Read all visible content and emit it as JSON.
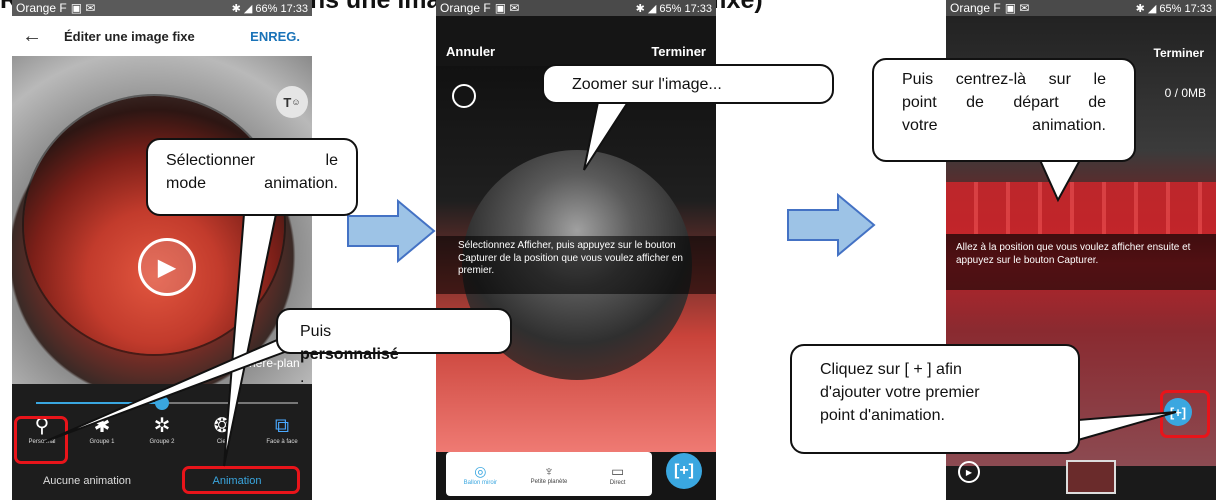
{
  "page_heading": "Réaliser une animation dans une image (vidéo point de vue fixe)",
  "phone1": {
    "status": {
      "carrier": "Orange F",
      "battery": "66%",
      "time": "17:33"
    },
    "back_icon": "arrow-left",
    "title": "Éditer une image fixe",
    "save_label": "ENREG.",
    "text_button": "T",
    "background_label": "Arrière-plan",
    "animation_progress": 0.48,
    "tools": [
      {
        "label": "Personnal",
        "icon": "personal-icon"
      },
      {
        "label": "Groupe 1",
        "icon": "group1-icon"
      },
      {
        "label": "Groupe 2",
        "icon": "group2-icon"
      },
      {
        "label": "Ciel",
        "icon": "sky-icon"
      },
      {
        "label": "Face à face",
        "icon": "face-to-face-icon"
      }
    ],
    "tabs": [
      "Aucune animation",
      "Animation"
    ]
  },
  "phone2": {
    "status": {
      "carrier": "Orange F",
      "battery": "65%",
      "time": "17:33"
    },
    "cancel_label": "Annuler",
    "done_label": "Terminer",
    "hint": "Sélectionnez Afficher, puis appuyez sur le bouton Capturer de la position que vous voulez afficher en premier.",
    "modes": [
      {
        "label": "Ballon miroir",
        "icon": "mirror-ball-icon"
      },
      {
        "label": "Petite planète",
        "icon": "little-planet-icon"
      },
      {
        "label": "Direct",
        "icon": "direct-icon"
      }
    ],
    "capture_icon": "[+]"
  },
  "phone3": {
    "status": {
      "carrier": "Orange F",
      "battery": "65%",
      "time": "17:33"
    },
    "done_label": "Terminer",
    "size_label": "0 / 0MB",
    "hint": "Allez à la position que vous voulez afficher ensuite et appuyez sur le bouton Capturer.",
    "capture_icon": "[+]"
  },
  "callouts": {
    "select_mode": [
      "Sélectionner le",
      "mode animation."
    ],
    "personalize_prefix": "Puis ",
    "personalize_bold": "personnalisé",
    "personalize_suffix": ".",
    "zoom": "Zoomer sur l'image...",
    "center": [
      "Puis centrez-là sur le",
      "point de départ de",
      "votre animation."
    ],
    "add_point": [
      "Cliquez sur [ + ] afin",
      "d'ajouter votre premier",
      "point d'animation."
    ]
  },
  "colors": {
    "accent": "#3aa7e0",
    "highlight": "#e8141a",
    "arrow_fill": "#9dc3e6",
    "arrow_stroke": "#4472c4"
  }
}
